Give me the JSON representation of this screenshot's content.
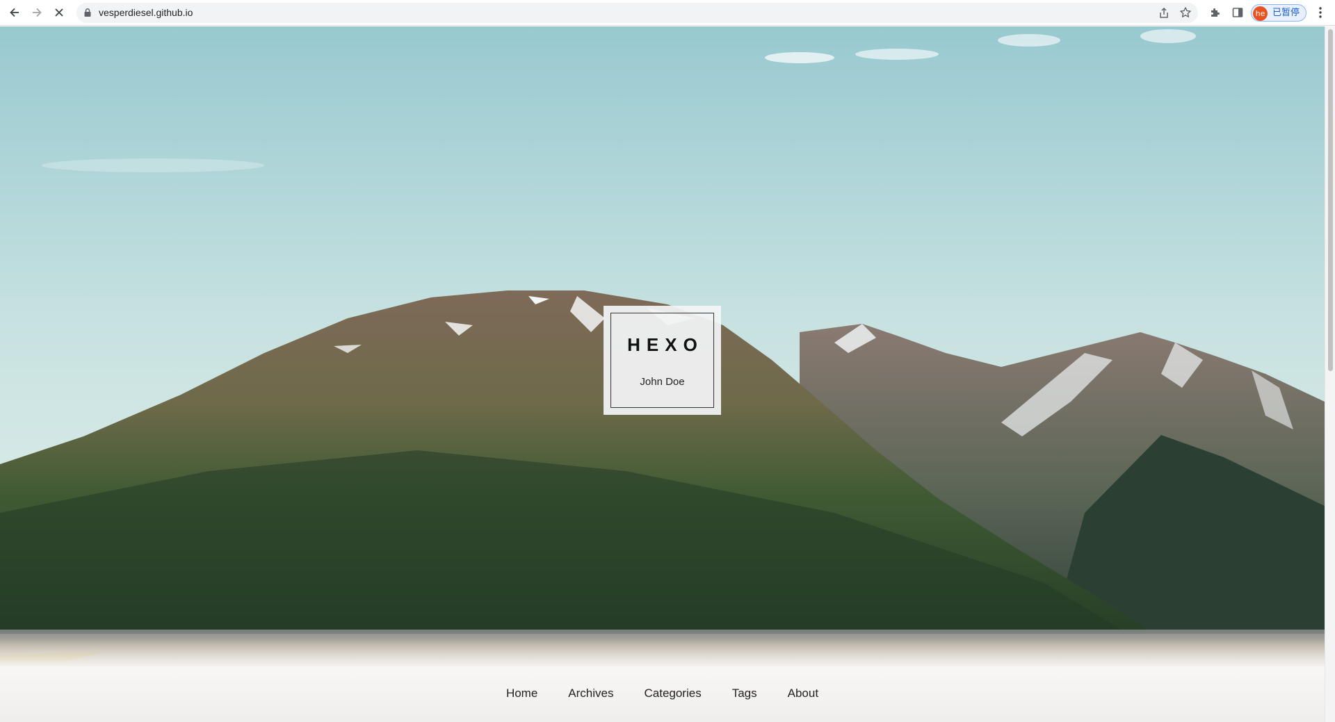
{
  "browser": {
    "url": "vesperdiesel.github.io",
    "profile_initials": "he",
    "profile_status": "已暂停",
    "icons": {
      "back": "arrow-left-icon",
      "forward": "arrow-right-icon",
      "stop": "close-icon",
      "lock": "lock-icon",
      "share": "share-icon",
      "bookmark": "star-icon",
      "extensions": "puzzle-icon",
      "side_panel": "side-panel-icon",
      "menu": "more-vertical-icon"
    },
    "accent_color": "#1a73e8",
    "avatar_color": "#e8541f"
  },
  "site": {
    "title": "HEXO",
    "subtitle": "John Doe",
    "nav": [
      {
        "label": "Home"
      },
      {
        "label": "Archives"
      },
      {
        "label": "Categories"
      },
      {
        "label": "Tags"
      },
      {
        "label": "About"
      }
    ]
  }
}
